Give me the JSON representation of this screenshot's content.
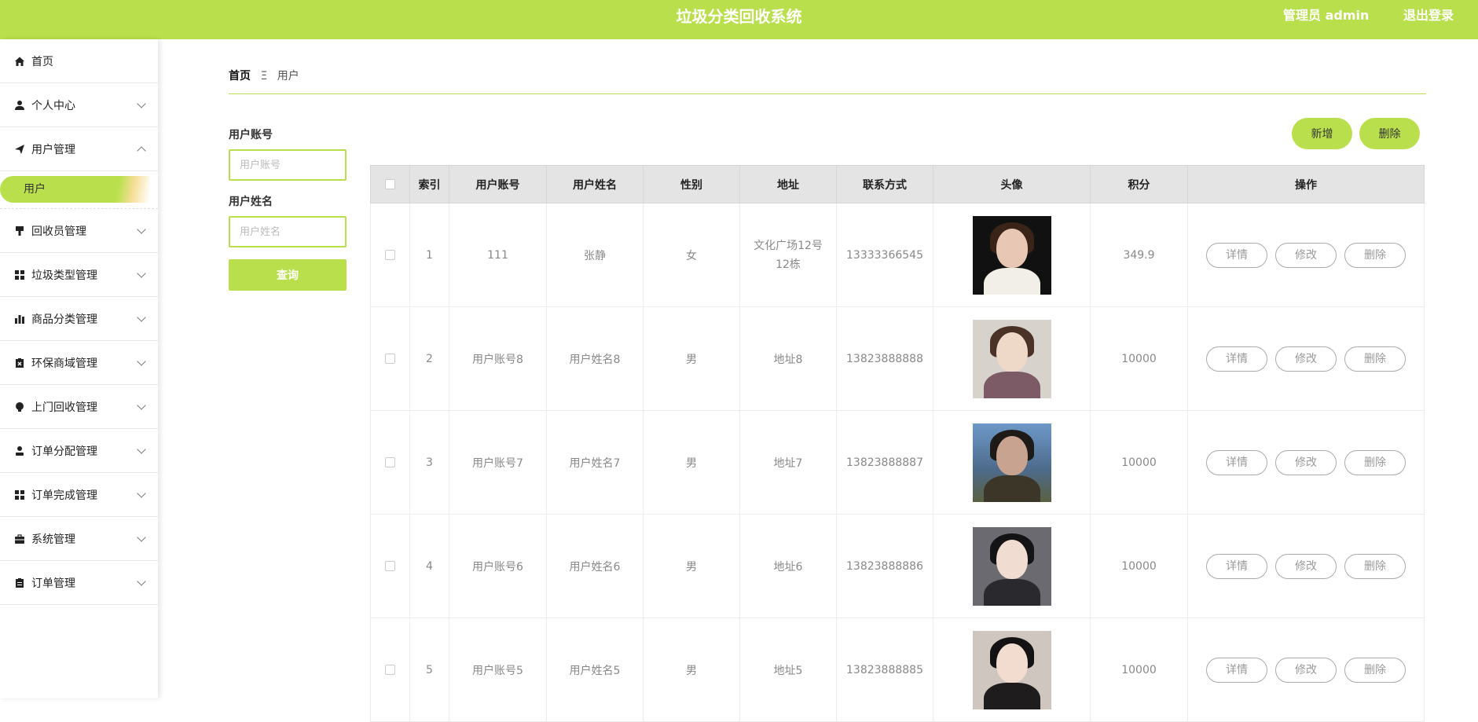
{
  "header": {
    "title": "垃圾分类回收系统",
    "user_label": "管理员 admin",
    "logout_label": "退出登录"
  },
  "sidebar": {
    "items": [
      {
        "label": "首页",
        "icon": "home-icon",
        "chevron": "none"
      },
      {
        "label": "个人中心",
        "icon": "user-icon",
        "chevron": "down"
      },
      {
        "label": "用户管理",
        "icon": "send-icon",
        "chevron": "up"
      },
      {
        "label": "回收员管理",
        "icon": "brush-icon",
        "chevron": "down"
      },
      {
        "label": "垃圾类型管理",
        "icon": "grid-icon",
        "chevron": "down"
      },
      {
        "label": "商品分类管理",
        "icon": "bar-chart-icon",
        "chevron": "down"
      },
      {
        "label": "环保商域管理",
        "icon": "clipboard-x-icon",
        "chevron": "down"
      },
      {
        "label": "上门回收管理",
        "icon": "bulb-icon",
        "chevron": "down"
      },
      {
        "label": "订单分配管理",
        "icon": "person-icon",
        "chevron": "down"
      },
      {
        "label": "订单完成管理",
        "icon": "grid-icon",
        "chevron": "down"
      },
      {
        "label": "系统管理",
        "icon": "briefcase-icon",
        "chevron": "down"
      },
      {
        "label": "订单管理",
        "icon": "clipboard-icon",
        "chevron": "down"
      }
    ],
    "submenu_label": "用户"
  },
  "breadcrumb": {
    "home": "首页",
    "separator": "Ξ",
    "current": "用户"
  },
  "filters": {
    "account_label": "用户账号",
    "account_placeholder": "用户账号",
    "name_label": "用户姓名",
    "name_placeholder": "用户姓名",
    "query_label": "查询"
  },
  "actions": {
    "add_label": "新增",
    "delete_label": "删除"
  },
  "table": {
    "headers": [
      "索引",
      "用户账号",
      "用户姓名",
      "性别",
      "地址",
      "联系方式",
      "头像",
      "积分",
      "操作"
    ],
    "rows": [
      {
        "index": "1",
        "account": "111",
        "name": "张静",
        "gender": "女",
        "address": "文化广场12号12栋",
        "phone": "13333366545",
        "points": "349.9"
      },
      {
        "index": "2",
        "account": "用户账号8",
        "name": "用户姓名8",
        "gender": "男",
        "address": "地址8",
        "phone": "13823888888",
        "points": "10000"
      },
      {
        "index": "3",
        "account": "用户账号7",
        "name": "用户姓名7",
        "gender": "男",
        "address": "地址7",
        "phone": "13823888887",
        "points": "10000"
      },
      {
        "index": "4",
        "account": "用户账号6",
        "name": "用户姓名6",
        "gender": "男",
        "address": "地址6",
        "phone": "13823888886",
        "points": "10000"
      },
      {
        "index": "5",
        "account": "用户账号5",
        "name": "用户姓名5",
        "gender": "男",
        "address": "地址5",
        "phone": "13823888885",
        "points": "10000"
      }
    ],
    "row_actions": {
      "detail": "详情",
      "edit": "修改",
      "delete": "删除"
    }
  },
  "colors": {
    "accent": "#b9e04c"
  }
}
